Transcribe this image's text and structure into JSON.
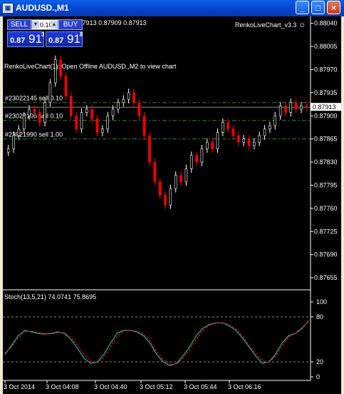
{
  "window": {
    "title": "AUDUSD.,M1",
    "app_icon": "terminal-icon",
    "buttons": {
      "minimize": "_",
      "maximize": "□",
      "close": "×"
    }
  },
  "chart": {
    "header": "AUDUSD.,M1  0.87909 0.87913 0.87909 0.87913",
    "ea_label": "RenkoLiveChart_v3.3",
    "ea_icon": "smiley-icon",
    "notice": "RenkoLiveChart(1): Open Offline AUDUSD.,M2 to view chart",
    "current_price": "0.87913",
    "colors": {
      "background": "#000000",
      "bull": "#ffffff",
      "bear": "#ff0000",
      "order_line": "#2e8b2e",
      "stoch_main": "#20b2aa",
      "stoch_signal": "#ff0000"
    },
    "order_lines": [
      {
        "label": "#23022145 sell 0.10",
        "price": 0.8792
      },
      {
        "label": "#23022106 sell 0.10",
        "price": 0.87893
      },
      {
        "label": "#23021990 sell 1.00",
        "price": 0.87865
      }
    ],
    "price_axis": [
      "0.88040",
      "0.88005",
      "0.87970",
      "0.87935",
      "0.87900",
      "0.87865",
      "0.87830",
      "0.87795",
      "0.87760",
      "0.87725",
      "0.87690",
      "0.87655"
    ],
    "time_axis": [
      "3 Oct 2014",
      "3 Oct 04:08",
      "3 Oct 04:40",
      "3 Oct 05:12",
      "3 Oct 05:44",
      "3 Oct 06:16"
    ]
  },
  "one_click": {
    "sell_label": "SELL",
    "buy_label": "BUY",
    "lot_value": "0.10",
    "sell_price_prefix": "0.87",
    "sell_price_big": "91",
    "sell_price_sup": "3",
    "buy_price_prefix": "0.87",
    "buy_price_big": "91",
    "buy_price_sup": "8"
  },
  "indicator": {
    "label": "Stoch(13,5,21) 74.0741 75.8695",
    "levels": [
      "100",
      "80",
      "20",
      "0"
    ]
  },
  "chart_data": {
    "type": "candlestick",
    "ylim": [
      0.8764,
      0.88045
    ],
    "close_series": [
      0.8785,
      0.8787,
      0.8788,
      0.879,
      0.8791,
      0.87905,
      0.8789,
      0.8792,
      0.8795,
      0.87985,
      0.8796,
      0.8793,
      0.879,
      0.8788,
      0.87905,
      0.8791,
      0.87895,
      0.87875,
      0.8788,
      0.879,
      0.8791,
      0.8792,
      0.87925,
      0.87935,
      0.8792,
      0.879,
      0.8787,
      0.8783,
      0.878,
      0.8778,
      0.87765,
      0.8779,
      0.8781,
      0.878,
      0.8782,
      0.8784,
      0.8783,
      0.8785,
      0.8786,
      0.8785,
      0.87875,
      0.8789,
      0.8788,
      0.8787,
      0.8786,
      0.87865,
      0.87855,
      0.8786,
      0.8787,
      0.8788,
      0.87885,
      0.879,
      0.87915,
      0.87905,
      0.8792,
      0.8791,
      0.87915,
      0.87913
    ],
    "stochastic": {
      "main": [
        30,
        42,
        55,
        62,
        60,
        58,
        57,
        58,
        60,
        58,
        50,
        38,
        25,
        18,
        20,
        30,
        45,
        58,
        62,
        62,
        60,
        55,
        45,
        30,
        20,
        15,
        18,
        28,
        40,
        55,
        65,
        70,
        72,
        72,
        68,
        62,
        52,
        40,
        28,
        18,
        20,
        30,
        45,
        55,
        58,
        65,
        74
      ],
      "signal": [
        32,
        40,
        52,
        60,
        61,
        59,
        58,
        57,
        59,
        59,
        53,
        42,
        30,
        21,
        19,
        26,
        40,
        54,
        61,
        62,
        61,
        57,
        48,
        34,
        23,
        17,
        17,
        25,
        36,
        50,
        62,
        69,
        72,
        72,
        70,
        64,
        55,
        43,
        31,
        21,
        19,
        27,
        41,
        53,
        58,
        63,
        75.87
      ],
      "levels": [
        80,
        20
      ],
      "ylim": [
        0,
        100
      ]
    }
  }
}
